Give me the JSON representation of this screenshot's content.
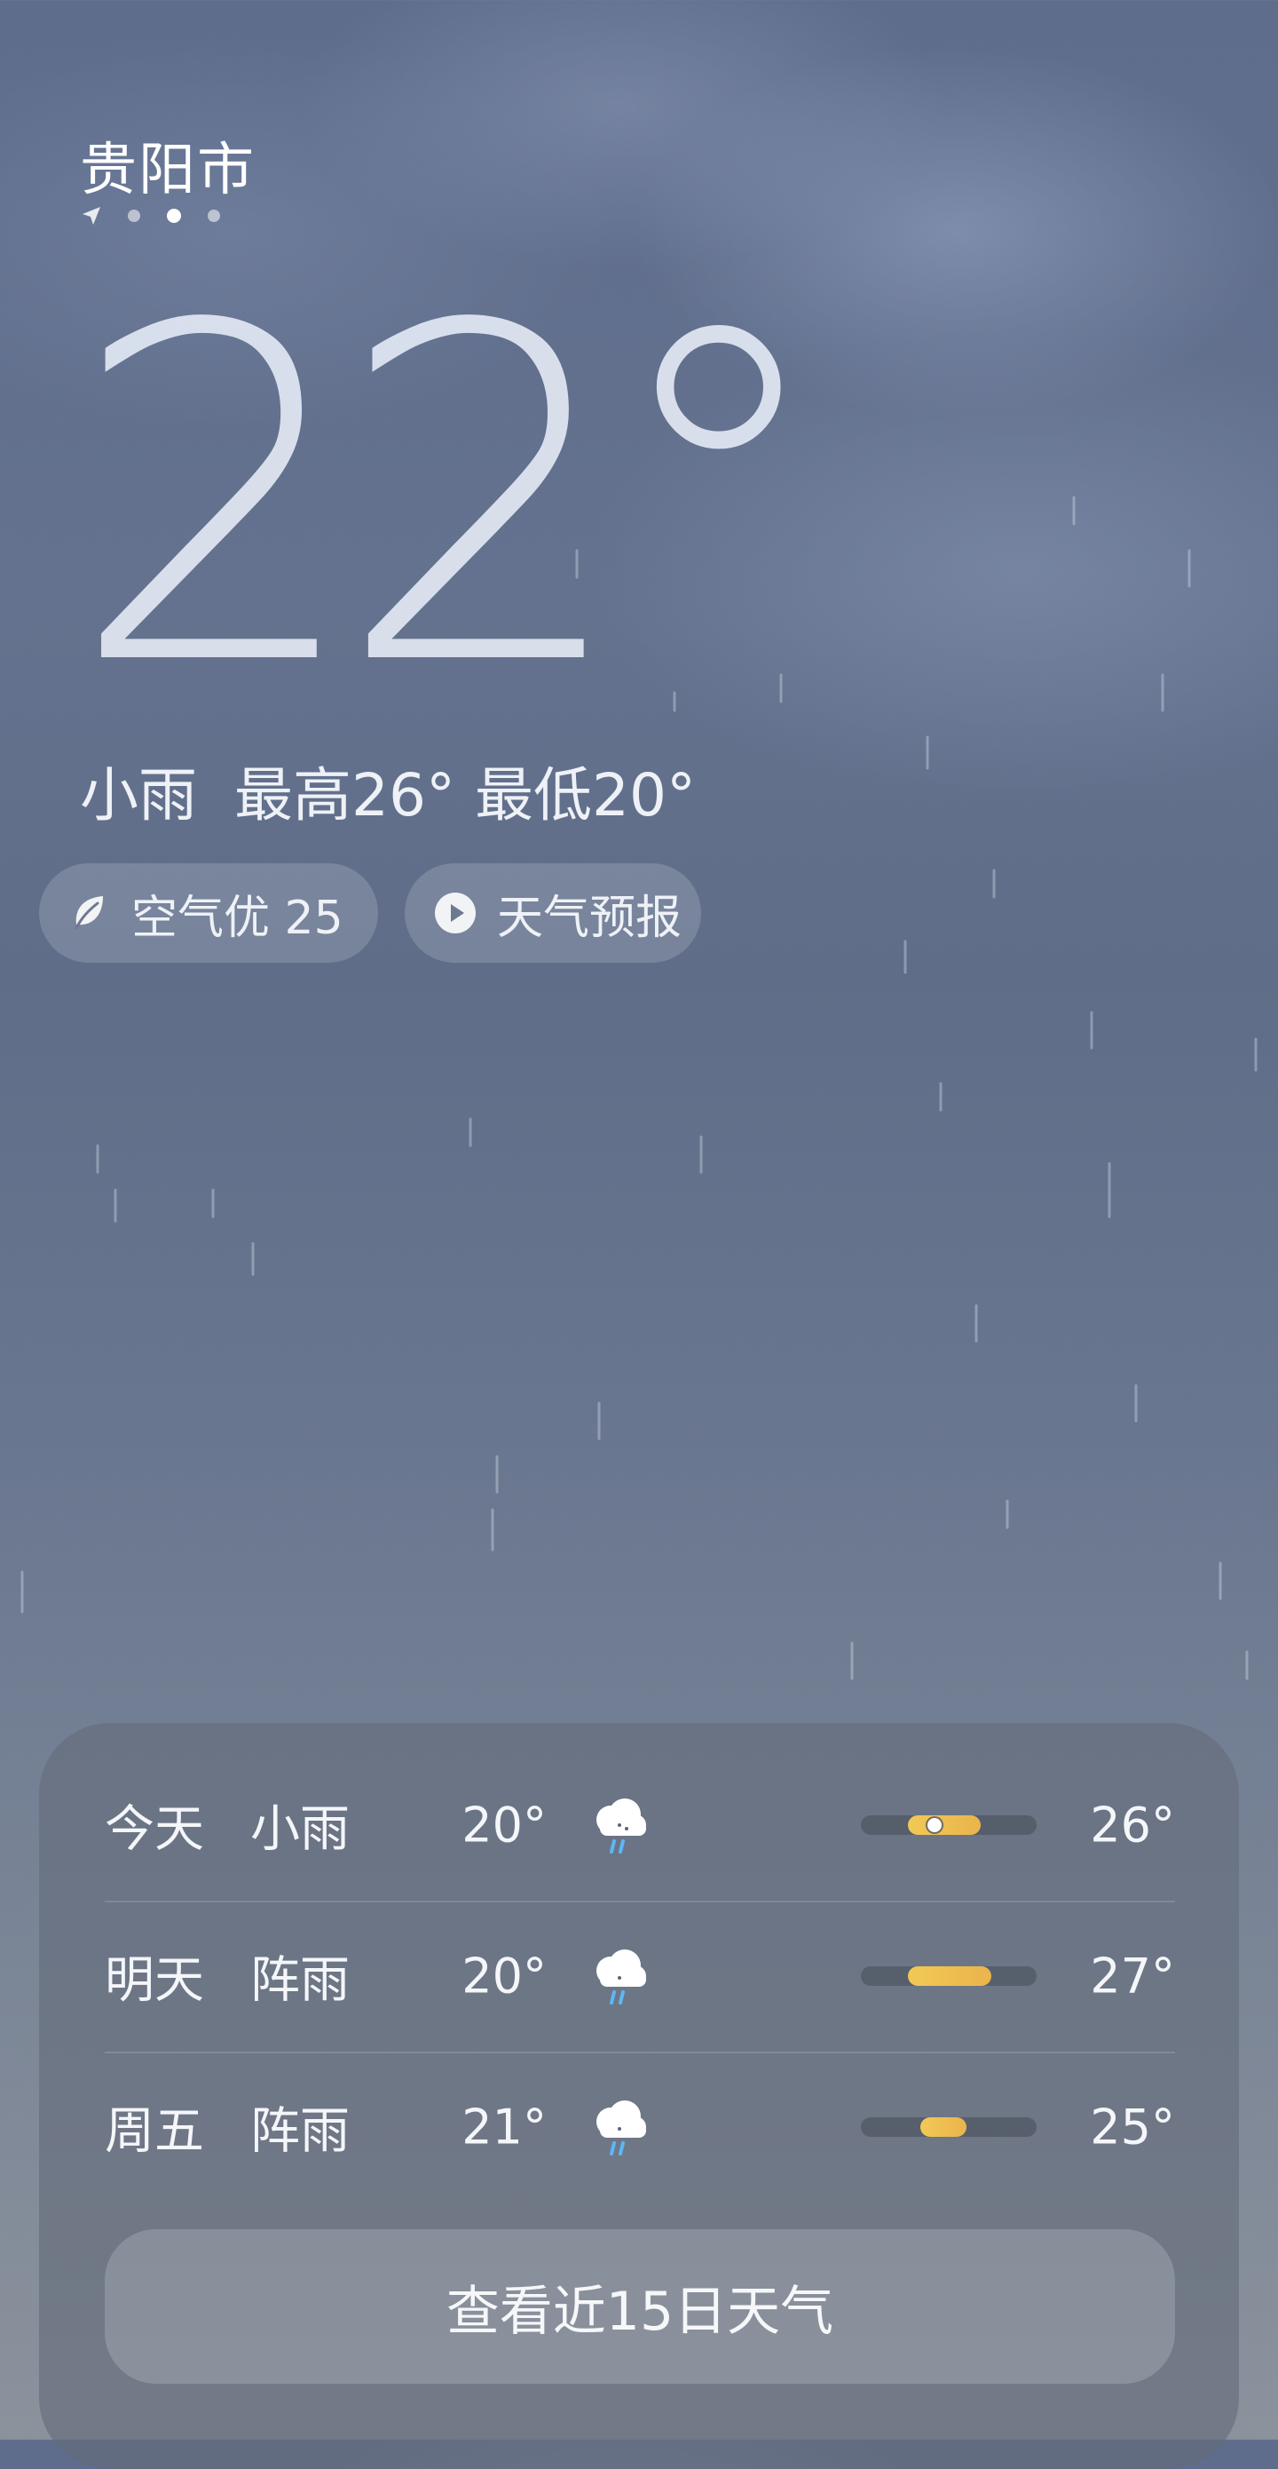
{
  "header": {
    "city": "贵阳市",
    "page_indicator": {
      "count": 3,
      "active_index": 1,
      "location_icon": "location-arrow-icon"
    }
  },
  "current": {
    "temperature": "22°",
    "condition": "小雨",
    "high": "最高26°",
    "low": "最低20°"
  },
  "chips": {
    "air": {
      "icon": "leaf-icon",
      "label": "空气优 25"
    },
    "forecast": {
      "icon": "play-icon",
      "label": "天气预报"
    }
  },
  "forecast": {
    "days": [
      {
        "day": "今天",
        "condition": "小雨",
        "icon": "cloud-rain-icon",
        "low": "20°",
        "high": "26°",
        "bar_start": 0.27,
        "bar_end": 0.68,
        "current_marker": 0.42
      },
      {
        "day": "明天",
        "condition": "阵雨",
        "icon": "cloud-showers-icon",
        "low": "20°",
        "high": "27°",
        "bar_start": 0.27,
        "bar_end": 0.74
      },
      {
        "day": "周五",
        "condition": "阵雨",
        "icon": "cloud-showers-icon",
        "low": "21°",
        "high": "25°",
        "bar_start": 0.34,
        "bar_end": 0.6
      }
    ],
    "more_label": "查看近15日天气"
  },
  "colors": {
    "bar_fill": "#f2c955",
    "card_bg": "#646c7a"
  }
}
